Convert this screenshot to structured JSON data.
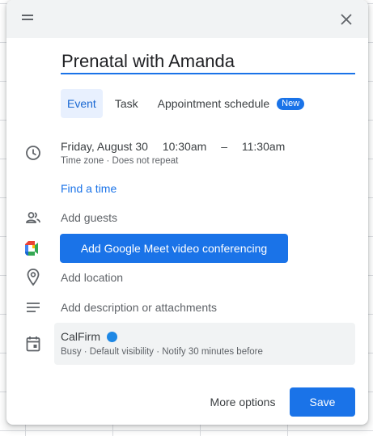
{
  "event": {
    "title": "Prenatal with Amanda"
  },
  "tabs": [
    {
      "label": "Event",
      "active": true
    },
    {
      "label": "Task",
      "active": false
    },
    {
      "label": "Appointment schedule",
      "active": false,
      "badge": "New"
    }
  ],
  "when": {
    "date": "Friday, August 30",
    "start": "10:30am",
    "separator": "–",
    "end": "11:30am",
    "details": "Time zone · Does not repeat"
  },
  "find_time_label": "Find a time",
  "guests_placeholder": "Add guests",
  "meet_button_label": "Add Google Meet video conferencing",
  "location_placeholder": "Add location",
  "description_placeholder": "Add description or attachments",
  "calendar": {
    "name": "CalFirm",
    "color": "#1e88e5",
    "details": "Busy · Default visibility · Notify 30 minutes before"
  },
  "footer": {
    "more_options_label": "More options",
    "save_label": "Save"
  },
  "icons": {
    "drag": "drag-handle-icon",
    "close": "close-icon",
    "clock": "clock-icon",
    "guests": "people-icon",
    "meet": "google-meet-icon",
    "location": "location-pin-icon",
    "description": "description-lines-icon",
    "calendar": "calendar-icon"
  },
  "colors": {
    "accent": "#1a73e8",
    "tab_active_bg": "#e8f0fe"
  }
}
